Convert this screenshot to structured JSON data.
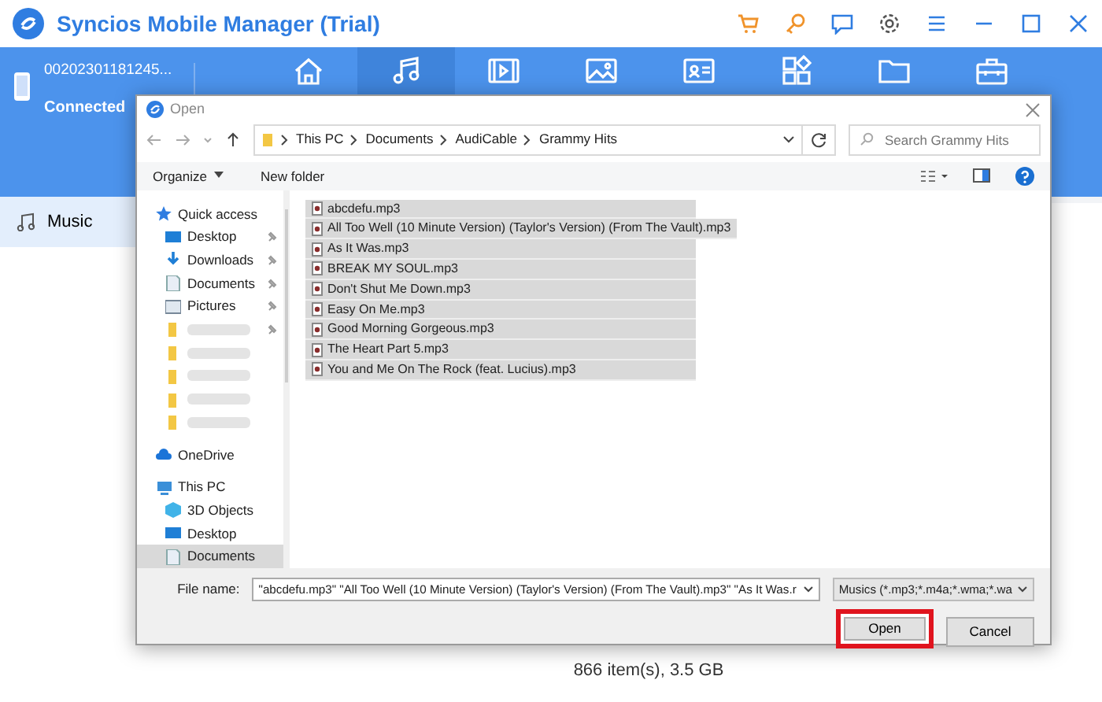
{
  "app": {
    "title": "Syncios Mobile Manager (Trial)",
    "device": {
      "id": "00202301181245...",
      "status": "Connected"
    },
    "nav_tabs": [
      {
        "kind": "home",
        "selected": false
      },
      {
        "kind": "music",
        "selected": true
      },
      {
        "kind": "video",
        "selected": false
      },
      {
        "kind": "photo",
        "selected": false
      },
      {
        "kind": "contacts",
        "selected": false
      },
      {
        "kind": "apps",
        "selected": false
      },
      {
        "kind": "files",
        "selected": false
      },
      {
        "kind": "toolbox",
        "selected": false
      }
    ],
    "sidebar": {
      "items": [
        {
          "label": "Music",
          "selected": true
        }
      ]
    },
    "status_bar": "866 item(s), 3.5 GB"
  },
  "dialog": {
    "title": "Open",
    "breadcrumb": [
      "This PC",
      "Documents",
      "AudiCable",
      "Grammy Hits"
    ],
    "search": {
      "placeholder": "Search Grammy Hits"
    },
    "toolbar": [
      "Organize",
      "New folder"
    ],
    "nav_pane": [
      {
        "label": "Quick access",
        "kind": "star",
        "children": [
          {
            "label": "Desktop",
            "kind": "desktop",
            "pinned": true,
            "selected": false
          },
          {
            "label": "Downloads",
            "kind": "download",
            "pinned": true,
            "selected": false
          },
          {
            "label": "Documents",
            "kind": "document",
            "pinned": true,
            "selected": false
          },
          {
            "label": "Pictures",
            "kind": "picture",
            "pinned": true,
            "selected": false
          },
          {
            "kind": "folder",
            "blurred": true,
            "pinned": true,
            "selected": false
          },
          {
            "kind": "folder",
            "blurred": true,
            "pinned": false,
            "selected": false
          },
          {
            "kind": "folder",
            "blurred": true,
            "pinned": false,
            "selected": false
          },
          {
            "kind": "folder",
            "blurred": true,
            "pinned": false,
            "selected": false
          },
          {
            "kind": "folder",
            "blurred": true,
            "pinned": false,
            "selected": false
          }
        ]
      },
      {
        "label": "OneDrive",
        "kind": "cloud"
      },
      {
        "label": "This PC",
        "kind": "pc",
        "children": [
          {
            "label": "3D Objects",
            "kind": "cube",
            "pinned": false,
            "selected": false
          },
          {
            "label": "Desktop",
            "kind": "desktop",
            "pinned": false,
            "selected": false
          },
          {
            "label": "Documents",
            "kind": "document",
            "pinned": false,
            "selected": true
          }
        ]
      }
    ],
    "files": [
      {
        "name": "abcdefu.mp3",
        "selected": true
      },
      {
        "name": "All Too Well (10 Minute Version) (Taylor's Version) (From The Vault).mp3",
        "selected": true
      },
      {
        "name": "As It Was.mp3",
        "selected": true
      },
      {
        "name": "BREAK MY SOUL.mp3",
        "selected": true
      },
      {
        "name": "Don't Shut Me Down.mp3",
        "selected": true
      },
      {
        "name": "Easy On Me.mp3",
        "selected": true
      },
      {
        "name": "Good Morning Gorgeous.mp3",
        "selected": true
      },
      {
        "name": "The Heart Part 5.mp3",
        "selected": true
      },
      {
        "name": "You and Me On The Rock (feat. Lucius).mp3",
        "selected": true
      }
    ],
    "file_name": {
      "label": "File name:",
      "value": "\"abcdefu.mp3\" \"All Too Well (10 Minute Version) (Taylor's Version) (From The Vault).mp3\" \"As It Was.r"
    },
    "file_type": {
      "value": "Musics (*.mp3;*.m4a;*.wma;*.wa"
    },
    "buttons": [
      {
        "label": "Open",
        "highlighted": true
      },
      {
        "label": "Cancel",
        "highlighted": false
      }
    ]
  }
}
